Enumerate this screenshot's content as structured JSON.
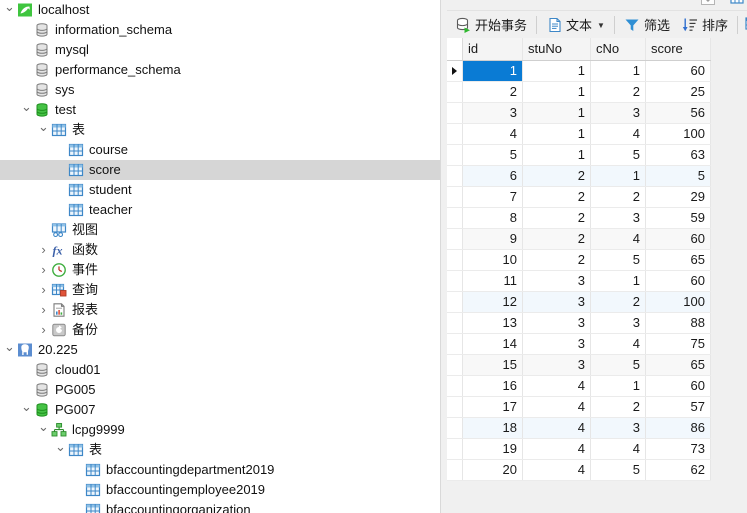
{
  "sidebar": {
    "nodes": [
      {
        "label": "localhost",
        "icon": "mysql-dolphin-icon",
        "indent": 0,
        "twisty": "open",
        "selected": false
      },
      {
        "label": "information_schema",
        "icon": "database-gray-icon",
        "indent": 1,
        "twisty": "none",
        "selected": false
      },
      {
        "label": "mysql",
        "icon": "database-gray-icon",
        "indent": 1,
        "twisty": "none",
        "selected": false
      },
      {
        "label": "performance_schema",
        "icon": "database-gray-icon",
        "indent": 1,
        "twisty": "none",
        "selected": false
      },
      {
        "label": "sys",
        "icon": "database-gray-icon",
        "indent": 1,
        "twisty": "none",
        "selected": false
      },
      {
        "label": "test",
        "icon": "database-green-icon",
        "indent": 1,
        "twisty": "open",
        "selected": false
      },
      {
        "label": "表",
        "icon": "table-folder-icon",
        "indent": 2,
        "twisty": "open",
        "selected": false
      },
      {
        "label": "course",
        "icon": "table-icon",
        "indent": 3,
        "twisty": "none",
        "selected": false
      },
      {
        "label": "score",
        "icon": "table-icon",
        "indent": 3,
        "twisty": "none",
        "selected": true
      },
      {
        "label": "student",
        "icon": "table-icon",
        "indent": 3,
        "twisty": "none",
        "selected": false
      },
      {
        "label": "teacher",
        "icon": "table-icon",
        "indent": 3,
        "twisty": "none",
        "selected": false
      },
      {
        "label": "视图",
        "icon": "view-icon",
        "indent": 2,
        "twisty": "none",
        "selected": false
      },
      {
        "label": "函数",
        "icon": "function-fx-icon",
        "indent": 2,
        "twisty": "closed",
        "selected": false
      },
      {
        "label": "事件",
        "icon": "event-clock-icon",
        "indent": 2,
        "twisty": "closed",
        "selected": false
      },
      {
        "label": "查询",
        "icon": "query-icon",
        "indent": 2,
        "twisty": "closed",
        "selected": false
      },
      {
        "label": "报表",
        "icon": "report-icon",
        "indent": 2,
        "twisty": "closed",
        "selected": false
      },
      {
        "label": "备份",
        "icon": "backup-icon",
        "indent": 2,
        "twisty": "closed",
        "selected": false
      },
      {
        "label": "20.225",
        "icon": "postgres-elephant-icon",
        "indent": 0,
        "twisty": "open",
        "selected": false
      },
      {
        "label": "cloud01",
        "icon": "database-gray-icon",
        "indent": 1,
        "twisty": "none",
        "selected": false
      },
      {
        "label": "PG005",
        "icon": "database-gray-icon",
        "indent": 1,
        "twisty": "none",
        "selected": false
      },
      {
        "label": "PG007",
        "icon": "database-green-icon",
        "indent": 1,
        "twisty": "open",
        "selected": false
      },
      {
        "label": "lcpg9999",
        "icon": "schema-green-icon",
        "indent": 2,
        "twisty": "open",
        "selected": false
      },
      {
        "label": "表",
        "icon": "table-folder-icon",
        "indent": 3,
        "twisty": "open",
        "selected": false
      },
      {
        "label": "bfaccountingdepartment2019",
        "icon": "table-icon",
        "indent": 4,
        "twisty": "none",
        "selected": false
      },
      {
        "label": "bfaccountingemployee2019",
        "icon": "table-icon",
        "indent": 4,
        "twisty": "none",
        "selected": false
      },
      {
        "label": "bfaccountingorganization",
        "icon": "table-icon",
        "indent": 4,
        "twisty": "none",
        "selected": false
      }
    ]
  },
  "toolbar": {
    "begin_transaction_label": "开始事务",
    "text_label": "文本",
    "filter_label": "筛选",
    "sort_label": "排序"
  },
  "grid": {
    "columns": [
      "id",
      "stuNo",
      "cNo",
      "score"
    ],
    "active_column": "id",
    "selected_row_index": 0,
    "rows": [
      {
        "id": "1",
        "stuNo": "1",
        "cNo": "1",
        "score": "60"
      },
      {
        "id": "2",
        "stuNo": "1",
        "cNo": "2",
        "score": "25"
      },
      {
        "id": "3",
        "stuNo": "1",
        "cNo": "3",
        "score": "56"
      },
      {
        "id": "4",
        "stuNo": "1",
        "cNo": "4",
        "score": "100"
      },
      {
        "id": "5",
        "stuNo": "1",
        "cNo": "5",
        "score": "63"
      },
      {
        "id": "6",
        "stuNo": "2",
        "cNo": "1",
        "score": "5"
      },
      {
        "id": "7",
        "stuNo": "2",
        "cNo": "2",
        "score": "29"
      },
      {
        "id": "8",
        "stuNo": "2",
        "cNo": "3",
        "score": "59"
      },
      {
        "id": "9",
        "stuNo": "2",
        "cNo": "4",
        "score": "60"
      },
      {
        "id": "10",
        "stuNo": "2",
        "cNo": "5",
        "score": "65"
      },
      {
        "id": "11",
        "stuNo": "3",
        "cNo": "1",
        "score": "60"
      },
      {
        "id": "12",
        "stuNo": "3",
        "cNo": "2",
        "score": "100"
      },
      {
        "id": "13",
        "stuNo": "3",
        "cNo": "3",
        "score": "88"
      },
      {
        "id": "14",
        "stuNo": "3",
        "cNo": "4",
        "score": "75"
      },
      {
        "id": "15",
        "stuNo": "3",
        "cNo": "5",
        "score": "65"
      },
      {
        "id": "16",
        "stuNo": "4",
        "cNo": "1",
        "score": "60"
      },
      {
        "id": "17",
        "stuNo": "4",
        "cNo": "2",
        "score": "57"
      },
      {
        "id": "18",
        "stuNo": "4",
        "cNo": "3",
        "score": "86"
      },
      {
        "id": "19",
        "stuNo": "4",
        "cNo": "4",
        "score": "73"
      },
      {
        "id": "20",
        "stuNo": "4",
        "cNo": "5",
        "score": "62"
      }
    ],
    "stripe_rows": [
      5,
      11,
      17
    ],
    "alt_rows": [
      2,
      8,
      14
    ]
  },
  "colors": {
    "selection_blue": "#0a7bd4",
    "tree_selection_gray": "#d6d6d6",
    "table_icon_blue": "#3d87c7",
    "mysql_green": "#2eb82e",
    "postgres_blue": "#4a7ebb",
    "panel_gray": "#f0f0f0"
  }
}
